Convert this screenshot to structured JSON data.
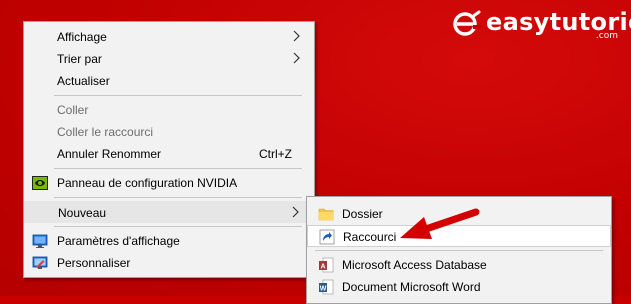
{
  "watermark": {
    "brand": "easytutoriel",
    "domain": ".com"
  },
  "context_menu": {
    "items": [
      {
        "label": "Affichage",
        "submenu": true
      },
      {
        "label": "Trier par",
        "submenu": true
      },
      {
        "label": "Actualiser"
      },
      {
        "label": "Coller",
        "disabled": true
      },
      {
        "label": "Coller le raccourci",
        "disabled": true
      },
      {
        "label": "Annuler Renommer",
        "shortcut": "Ctrl+Z"
      },
      {
        "label": "Panneau de configuration NVIDIA",
        "icon": "nvidia-icon"
      },
      {
        "label": "Nouveau",
        "submenu": true,
        "highlighted": true
      },
      {
        "label": "Paramètres d'affichage",
        "icon": "display-settings-icon"
      },
      {
        "label": "Personnaliser",
        "icon": "personalize-icon"
      }
    ]
  },
  "submenu_new": {
    "items": [
      {
        "label": "Dossier",
        "icon": "folder-icon"
      },
      {
        "label": "Raccourci",
        "icon": "shortcut-icon",
        "highlighted": true
      },
      {
        "label": "Microsoft Access Database",
        "icon": "access-icon"
      },
      {
        "label": "Document Microsoft Word",
        "icon": "word-icon"
      }
    ]
  },
  "colors": {
    "desktop_background": "#c80000",
    "menu_background": "#f2f2f2",
    "highlight": "#e6e6e6",
    "annotation_arrow": "#d40000"
  }
}
